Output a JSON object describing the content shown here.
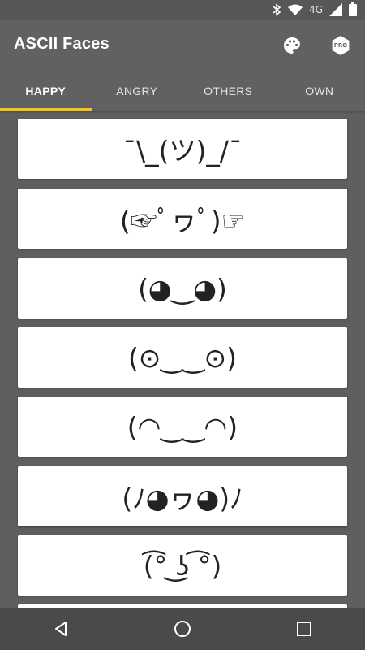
{
  "status_bar": {
    "network_label": "4G",
    "icons": [
      "bluetooth-icon",
      "wifi-icon",
      "signal-icon",
      "battery-icon"
    ]
  },
  "app_bar": {
    "title": "ASCII Faces",
    "actions": [
      "palette-icon",
      "pro-badge-icon"
    ],
    "pro_label": "PRO"
  },
  "tabs": [
    {
      "label": "HAPPY",
      "active": true
    },
    {
      "label": "ANGRY",
      "active": false
    },
    {
      "label": "OTHERS",
      "active": false
    },
    {
      "label": "OWN",
      "active": false
    }
  ],
  "faces": [
    "¯\\_(ツ)_/¯",
    "(☞ﾟヮﾟ)☞",
    "(◕‿◕)",
    "(⊙‿‿⊙)",
    "(◠‿‿◠)",
    "(ﾉ◕ヮ◕)ﾉ",
    "(͡° ͜ʖ ͡°)"
  ],
  "colors": {
    "accent": "#f5c518",
    "app_bar": "#616161",
    "background": "#5f5f5f",
    "nav_bar": "#4a4a4a"
  },
  "nav_bar": {
    "buttons": [
      "back-icon",
      "home-icon",
      "recents-icon"
    ]
  }
}
